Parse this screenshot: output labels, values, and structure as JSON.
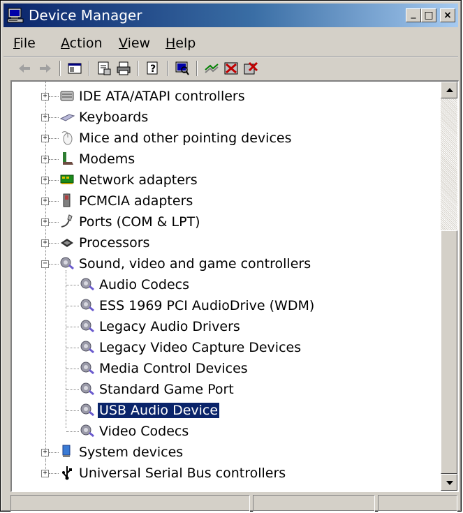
{
  "window": {
    "title": "Device Manager",
    "minimize_glyph": "_",
    "maximize_glyph": "□",
    "close_glyph": "×"
  },
  "menu": [
    {
      "label": "File",
      "accel": "F",
      "rest": "ile"
    },
    {
      "label": "Action",
      "accel": "A",
      "rest": "ction"
    },
    {
      "label": "View",
      "accel": "V",
      "rest": "iew"
    },
    {
      "label": "Help",
      "accel": "H",
      "rest": "elp"
    }
  ],
  "toolbar": [
    {
      "icon": "back-arrow-icon"
    },
    {
      "icon": "forward-arrow-icon"
    },
    {
      "icon": "show-hide-console-tree-icon"
    },
    {
      "icon": "properties-icon"
    },
    {
      "icon": "print-icon"
    },
    {
      "icon": "help-icon"
    },
    {
      "icon": "scan-hardware-changes-icon"
    },
    {
      "icon": "update-driver-icon"
    },
    {
      "icon": "disable-device-icon"
    },
    {
      "icon": "uninstall-device-icon"
    }
  ],
  "tree": {
    "categories_top": [
      {
        "label": "IDE ATA/ATAPI controllers",
        "icon": "ide-controller-icon",
        "expanded": false
      },
      {
        "label": "Keyboards",
        "icon": "keyboard-icon",
        "expanded": false
      },
      {
        "label": "Mice and other pointing devices",
        "icon": "mouse-icon",
        "expanded": false
      },
      {
        "label": "Modems",
        "icon": "modem-icon",
        "expanded": false
      },
      {
        "label": "Network adapters",
        "icon": "network-adapter-icon",
        "expanded": false
      },
      {
        "label": "PCMCIA adapters",
        "icon": "pcmcia-icon",
        "expanded": false
      },
      {
        "label": "Ports (COM & LPT)",
        "icon": "port-icon",
        "expanded": false
      },
      {
        "label": "Processors",
        "icon": "processor-icon",
        "expanded": false
      },
      {
        "label": "Sound, video and game controllers",
        "icon": "sound-icon",
        "expanded": true
      }
    ],
    "sound_children": [
      {
        "label": "Audio Codecs",
        "selected": false
      },
      {
        "label": "ESS 1969 PCI AudioDrive (WDM)",
        "selected": false
      },
      {
        "label": "Legacy Audio Drivers",
        "selected": false
      },
      {
        "label": "Legacy Video Capture Devices",
        "selected": false
      },
      {
        "label": "Media Control Devices",
        "selected": false
      },
      {
        "label": "Standard Game Port",
        "selected": false
      },
      {
        "label": "USB Audio Device",
        "selected": true
      },
      {
        "label": "Video Codecs",
        "selected": false
      }
    ],
    "categories_bottom": [
      {
        "label": "System devices",
        "icon": "system-devices-icon",
        "expanded": false
      },
      {
        "label": "Universal Serial Bus controllers",
        "icon": "usb-icon",
        "expanded": false
      }
    ],
    "expand_glyph": "+",
    "collapse_glyph": "−"
  },
  "colors": {
    "title_gradient_start": "#0a246a",
    "title_gradient_end": "#a6caf0",
    "selection_bg": "#0a246a",
    "face": "#d4d0c8"
  }
}
